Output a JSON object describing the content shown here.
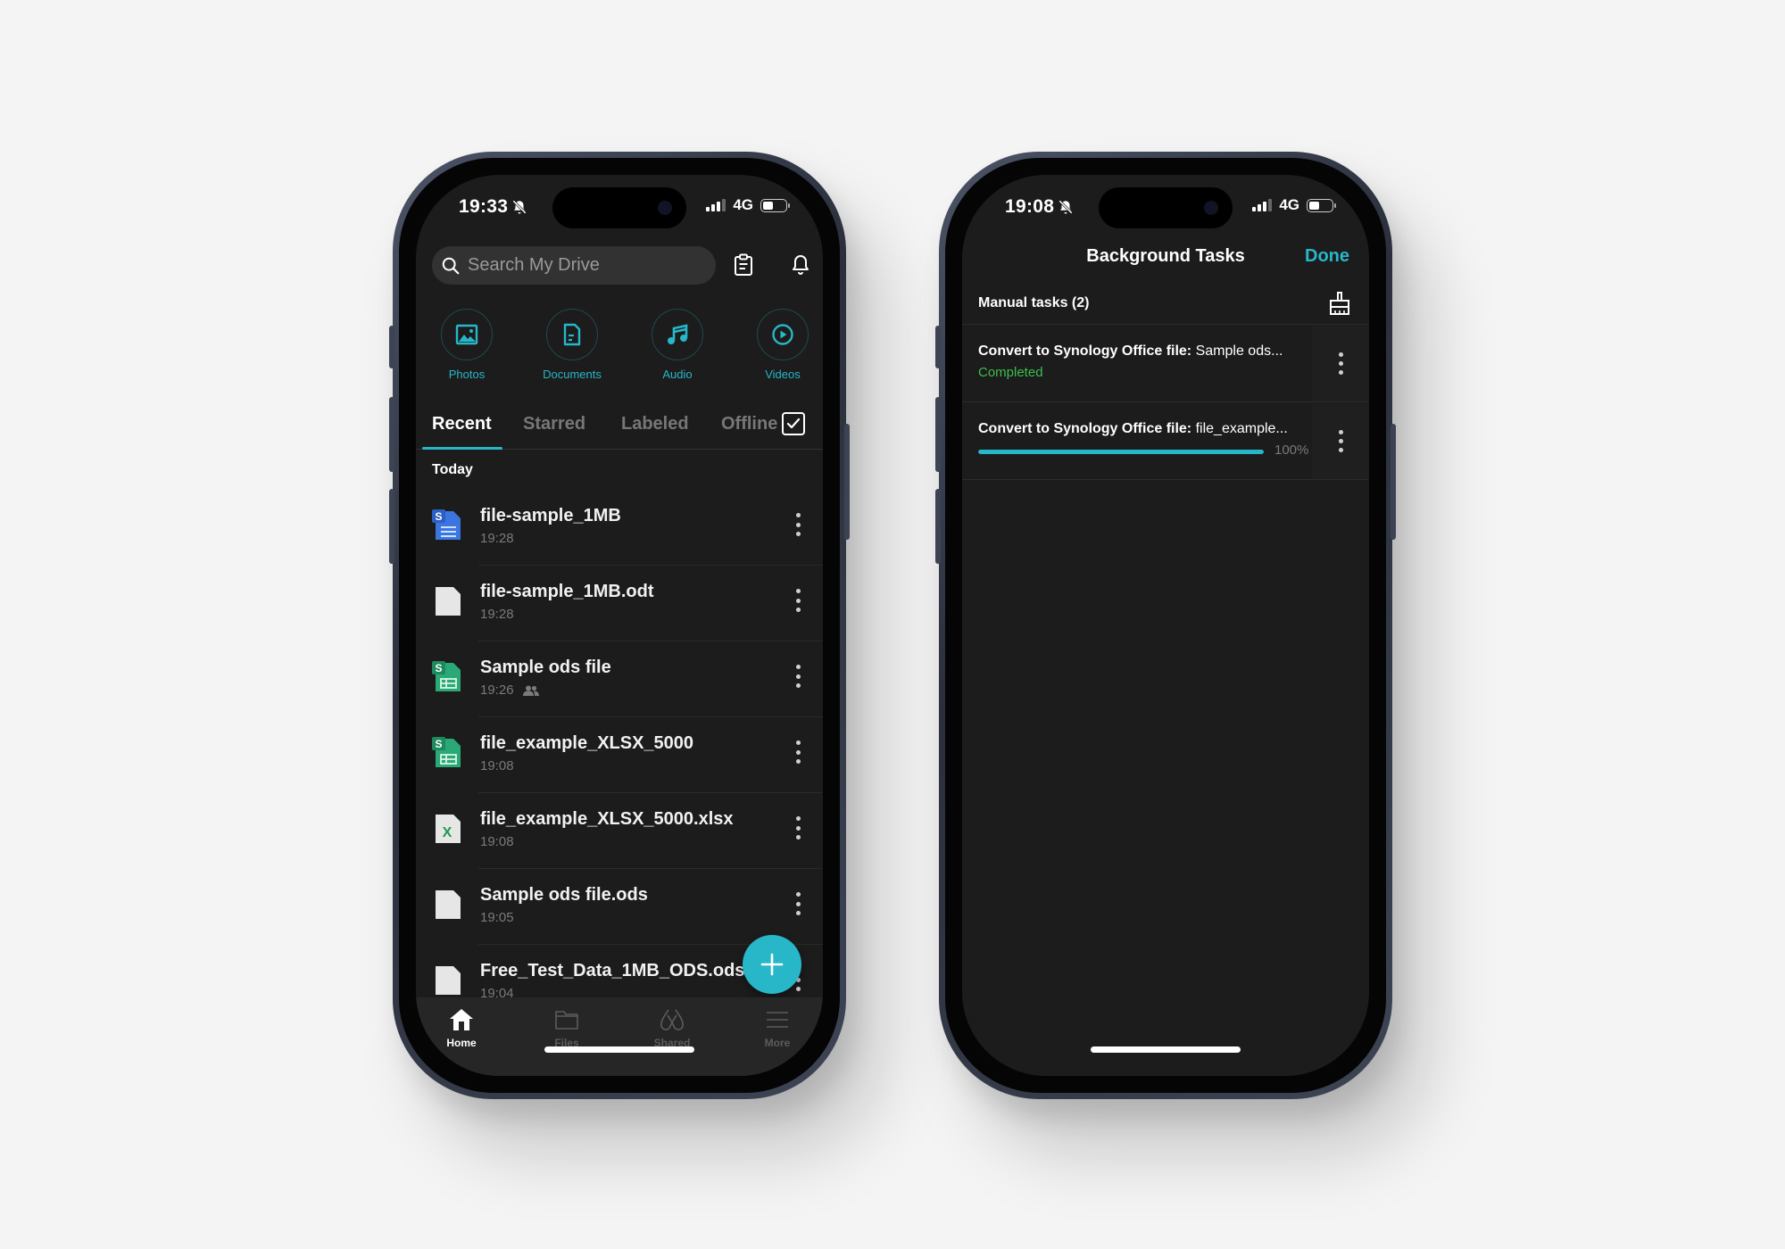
{
  "left_phone": {
    "status_bar": {
      "time": "19:33",
      "network": "4G",
      "battery_percent": 45
    },
    "search": {
      "placeholder": "Search My Drive"
    },
    "header_icons": [
      "clipboard-icon",
      "bell-icon"
    ],
    "categories": [
      {
        "label": "Photos",
        "icon": "photo-icon"
      },
      {
        "label": "Documents",
        "icon": "document-icon"
      },
      {
        "label": "Audio",
        "icon": "music-icon"
      },
      {
        "label": "Videos",
        "icon": "play-icon"
      }
    ],
    "tabs": [
      {
        "label": "Recent",
        "active": true
      },
      {
        "label": "Starred",
        "active": false
      },
      {
        "label": "Labeled",
        "active": false
      },
      {
        "label": "Offline",
        "active": false
      }
    ],
    "section_title": "Today",
    "files": [
      {
        "name": "file-sample_1MB",
        "time": "19:28",
        "type": "synology-doc",
        "shared": false
      },
      {
        "name": "file-sample_1MB.odt",
        "time": "19:28",
        "type": "generic",
        "shared": false
      },
      {
        "name": "Sample ods file",
        "time": "19:26",
        "type": "synology-sheet",
        "shared": true
      },
      {
        "name": "file_example_XLSX_5000",
        "time": "19:08",
        "type": "synology-sheet",
        "shared": false
      },
      {
        "name": "file_example_XLSX_5000.xlsx",
        "time": "19:08",
        "type": "excel",
        "shared": false
      },
      {
        "name": "Sample ods file.ods",
        "time": "19:05",
        "type": "generic",
        "shared": false
      },
      {
        "name": "Free_Test_Data_1MB_ODS.ods",
        "time": "19:04",
        "type": "generic",
        "shared": false
      }
    ],
    "bottom_nav": [
      {
        "label": "Home",
        "active": true
      },
      {
        "label": "Files",
        "active": false
      },
      {
        "label": "Shared",
        "active": false
      },
      {
        "label": "More",
        "active": false
      }
    ]
  },
  "right_phone": {
    "status_bar": {
      "time": "19:08",
      "network": "4G",
      "battery_percent": 45
    },
    "nav": {
      "title": "Background Tasks",
      "done_label": "Done"
    },
    "group": {
      "title": "Manual tasks (2)"
    },
    "tasks": [
      {
        "action": "Convert to Synology Office file:",
        "target": "Sample ods...",
        "status": "Completed"
      },
      {
        "action": "Convert to Synology Office file:",
        "target": "file_example...",
        "progress_percent": 100,
        "progress_label": "100%"
      }
    ]
  },
  "colors": {
    "accent": "#27b7c9",
    "success": "#3bbf4a",
    "background": "#1c1c1c"
  }
}
